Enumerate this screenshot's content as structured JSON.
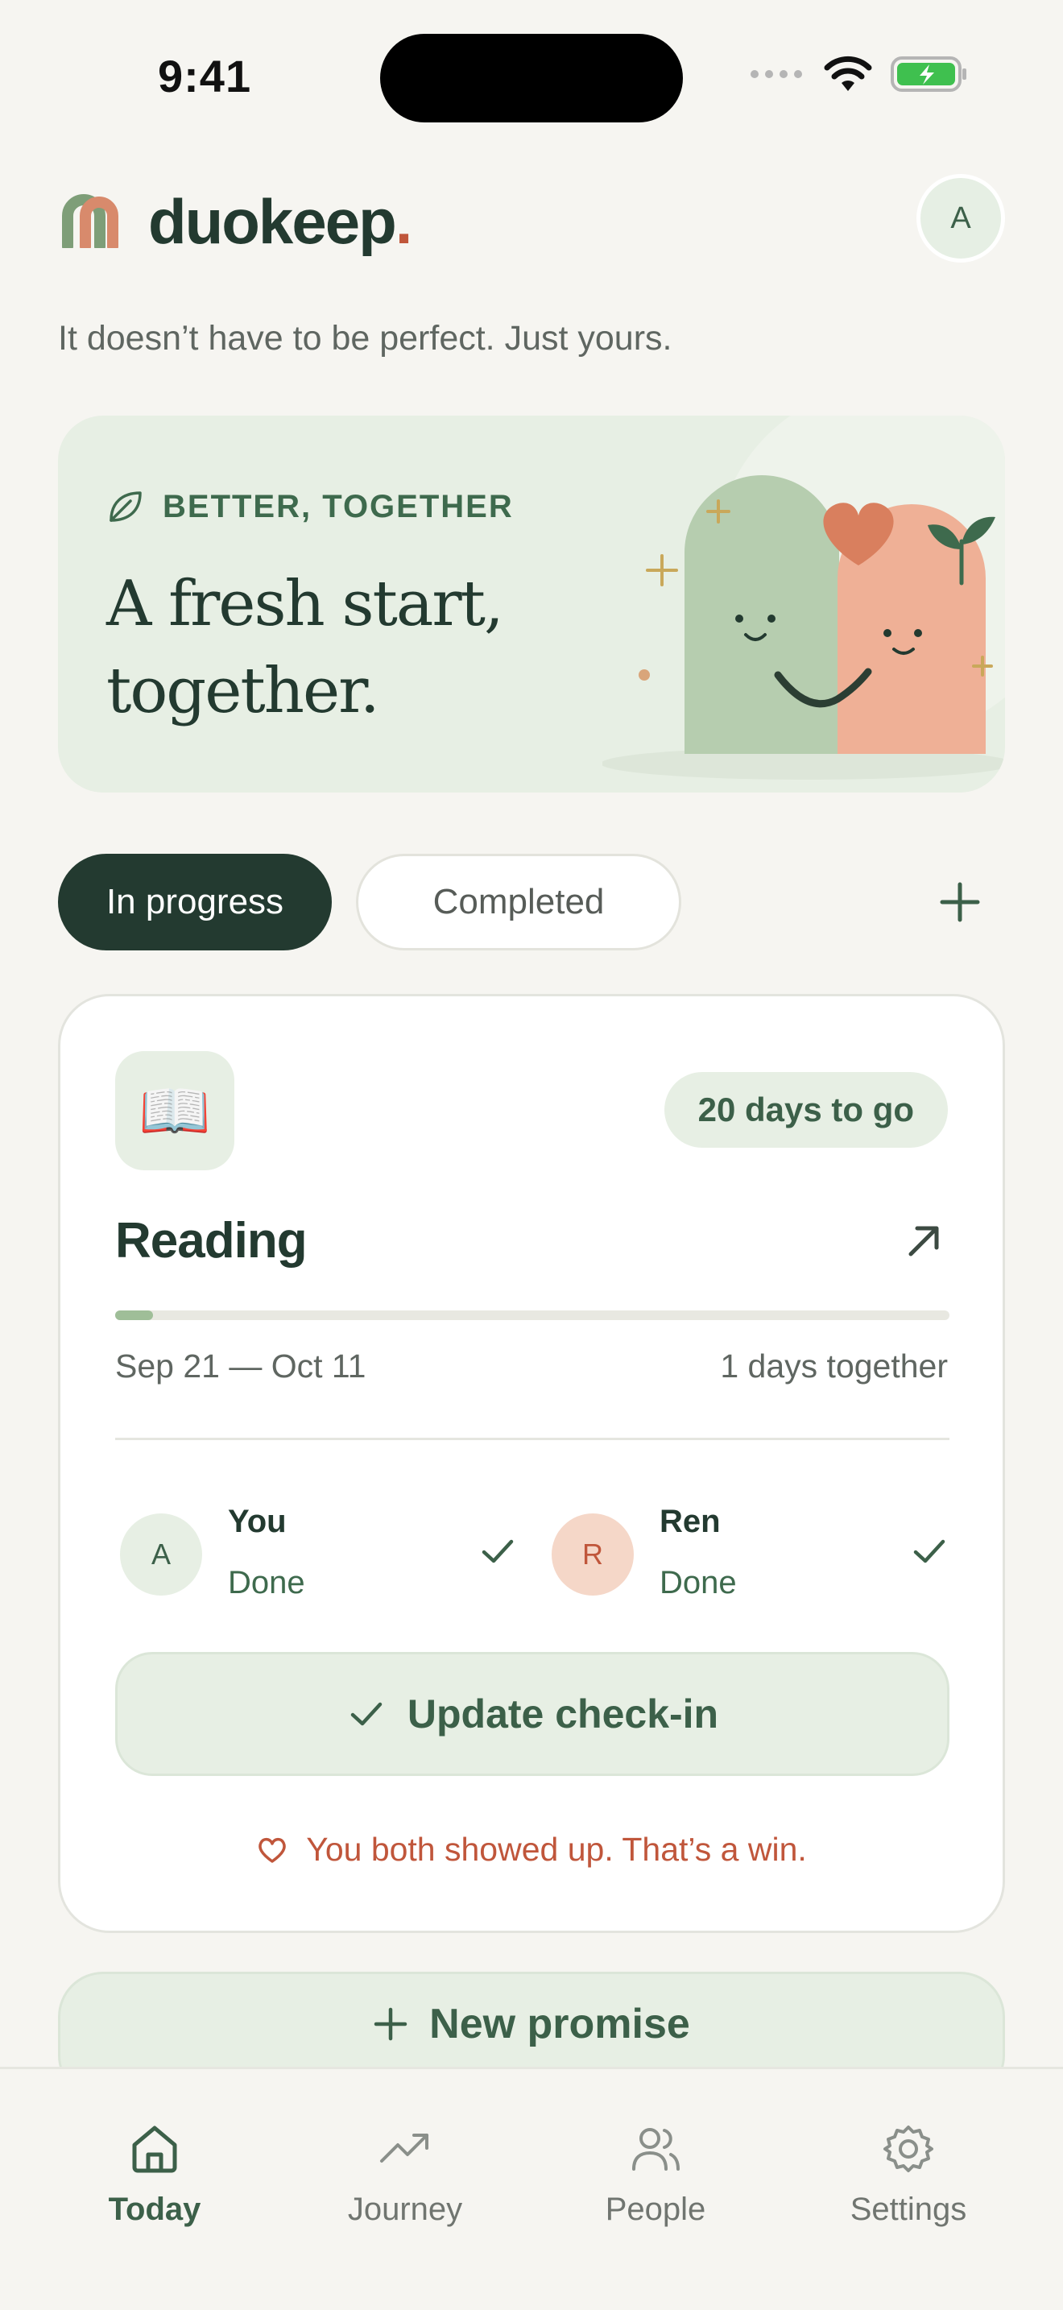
{
  "status": {
    "time": "9:41"
  },
  "brand": {
    "name": "duokeep",
    "dot": ".",
    "avatar_initial": "A"
  },
  "tagline": "It doesn’t have to be perfect. Just yours.",
  "hero": {
    "kicker": "BETTER, TOGETHER",
    "title": "A fresh start, together."
  },
  "tabs": {
    "active_label": "In progress",
    "inactive_label": "Completed"
  },
  "goal": {
    "icon": "📖",
    "badge": "20 days to go",
    "title": "Reading",
    "progress": 0.045,
    "date_range": "Sep 21 — Oct 11",
    "days_together": "1 days together",
    "members": [
      {
        "initial": "A",
        "name": "You",
        "status": "Done",
        "avatar_bg": "#e7efe4",
        "avatar_color": "#3c6049"
      },
      {
        "initial": "R",
        "name": "Ren",
        "status": "Done",
        "avatar_bg": "#f5d7c8",
        "avatar_color": "#c0563b"
      }
    ],
    "checkin_label": "Update check-in",
    "win_note": "You both showed up. That’s a win."
  },
  "new_promise_label": "New promise",
  "nav": {
    "items": [
      {
        "label": "Today",
        "icon": "home-icon"
      },
      {
        "label": "Journey",
        "icon": "trend-up-icon"
      },
      {
        "label": "People",
        "icon": "people-icon"
      },
      {
        "label": "Settings",
        "icon": "gear-icon"
      }
    ]
  },
  "colors": {
    "accent": "#233a30",
    "soft_green": "#e7efe4",
    "coral": "#c0563b",
    "background": "#f6f5f1"
  }
}
